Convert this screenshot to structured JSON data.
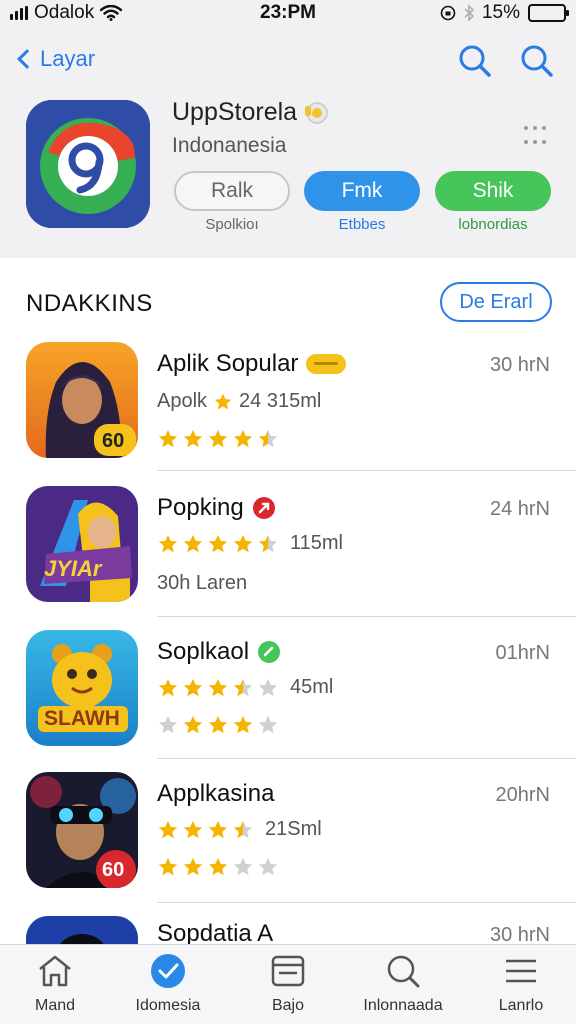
{
  "status": {
    "carrier": "Odalok",
    "time": "23:PM",
    "battery": "15%",
    "battery_level": 0.85
  },
  "header": {
    "back_label": "Layar",
    "app_name": "UppStorela",
    "app_subtitle": "Indonanesia",
    "pills": [
      {
        "label": "Ralk",
        "caption": "Spolkioı"
      },
      {
        "label": "Fmk",
        "caption": "Etbbes"
      },
      {
        "label": "Shik",
        "caption": "lobnordias"
      }
    ]
  },
  "section": {
    "title": "NDAKKINS",
    "see_all": "De Erarl"
  },
  "apps": [
    {
      "name": "Aplik Sopular",
      "meta": "Apolk",
      "meta_value": "24 315ml",
      "size": "30 hrN",
      "rating": 4.5,
      "icon_badge": "60"
    },
    {
      "name": "Popking",
      "meta_value": "115ml",
      "line2": "30h Laren",
      "size": "24 hrN",
      "rating": 4.5,
      "icon_text": "JYIAr"
    },
    {
      "name": "Soplkaol",
      "meta_value": "45ml",
      "size": "01hrN",
      "rating": 3.5,
      "rating2": 4,
      "icon_text": "SLAWH"
    },
    {
      "name": "Applkasina",
      "meta_value": "21Sml",
      "size": "20hrN",
      "rating": 3.5,
      "rating2": 3,
      "icon_badge": "60"
    },
    {
      "name": "Sopdatia A",
      "size": "30 hrN"
    }
  ],
  "tabs": [
    {
      "label": "Mand",
      "icon": "home-icon"
    },
    {
      "label": "Idomesia",
      "icon": "check-badge-icon"
    },
    {
      "label": "Bajo",
      "icon": "card-icon"
    },
    {
      "label": "Inlonnaada",
      "icon": "search-icon"
    },
    {
      "label": "Lanrlo",
      "icon": "list-icon"
    }
  ],
  "colors": {
    "accent": "#2a7be4",
    "star": "#f4b400",
    "star_empty": "#cfcfd4",
    "green_pill": "#46c55a"
  }
}
